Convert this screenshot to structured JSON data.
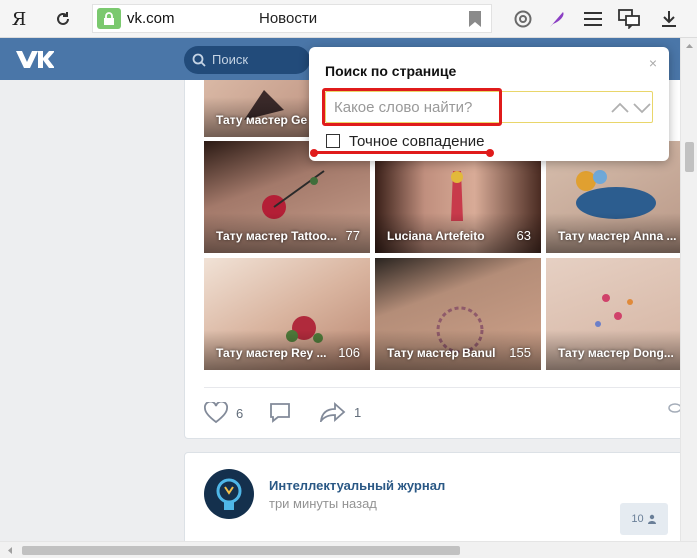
{
  "browser": {
    "yandex_label": "Я",
    "url": "vk.com",
    "page_title": "Новости"
  },
  "vk": {
    "search_placeholder": "Поиск"
  },
  "tiles": [
    {
      "title": "Тату мастер Ge",
      "count": ""
    },
    {
      "title": "Тату мастер Tattoo...",
      "count": "77"
    },
    {
      "title": "Luciana Artefeito",
      "count": "63"
    },
    {
      "title": "Тату мастер Anna ...",
      "count": ""
    },
    {
      "title": "Тату мастер Rey ...",
      "count": "106"
    },
    {
      "title": "Тату мастер Banul",
      "count": "155"
    },
    {
      "title": "Тату мастер Dong...",
      "count": ""
    }
  ],
  "post_actions": {
    "likes": "6",
    "shares": "1"
  },
  "next_post": {
    "author": "Интеллектуальный журнал",
    "time": "три минуты назад",
    "views": "10"
  },
  "find": {
    "title": "Поиск по странице",
    "placeholder": "Какое слово найти?",
    "exact_label": "Точное совпадение",
    "close": "×"
  },
  "colors": {
    "vk_header": "#4a76a8",
    "highlight": "#e01b1b"
  }
}
